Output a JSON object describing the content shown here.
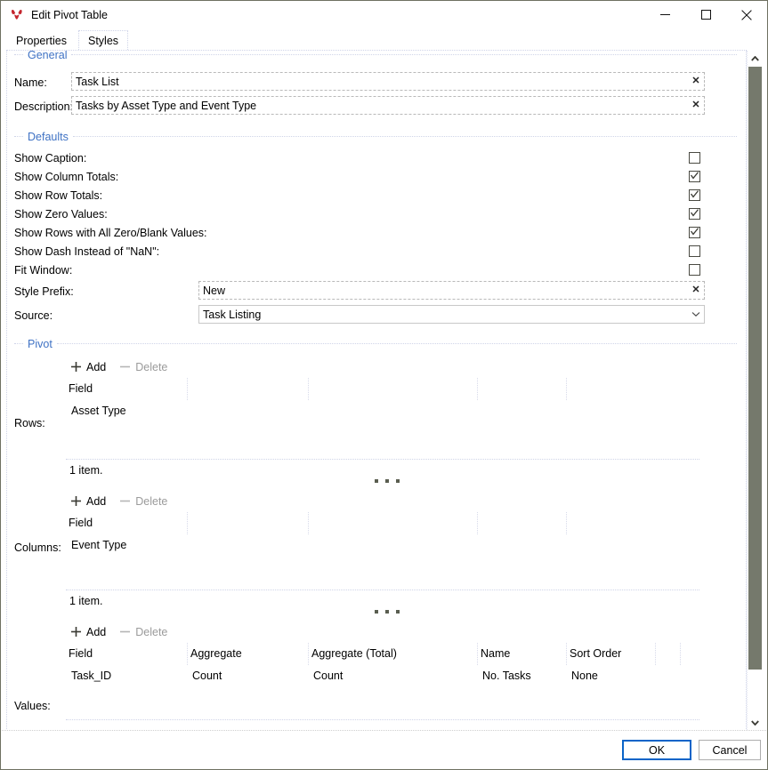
{
  "window": {
    "title": "Edit Pivot Table",
    "icon": "pivot-table-icon",
    "controls": {
      "minimize": "minimize-icon",
      "maximize": "maximize-icon",
      "close": "close-icon"
    }
  },
  "tabs": [
    {
      "label": "Properties",
      "selected": true
    },
    {
      "label": "Styles",
      "selected": false
    }
  ],
  "groups": {
    "general": "General",
    "defaults": "Defaults",
    "pivot": "Pivot"
  },
  "general": {
    "name_label": "Name:",
    "name_value": "Task List",
    "description_label": "Description:",
    "description_value": "Tasks by Asset Type and Event Type",
    "clear_icon": "clear-icon"
  },
  "defaults": {
    "checkboxes": [
      {
        "label": "Show Caption:",
        "checked": false
      },
      {
        "label": "Show Column Totals:",
        "checked": true
      },
      {
        "label": "Show Row Totals:",
        "checked": true
      },
      {
        "label": "Show Zero Values:",
        "checked": true
      },
      {
        "label": "Show Rows with All Zero/Blank Values:",
        "checked": true
      },
      {
        "label": "Show Dash Instead of \"NaN\":",
        "checked": false
      },
      {
        "label": "Fit Window:",
        "checked": false
      }
    ],
    "style_prefix_label": "Style Prefix:",
    "style_prefix_value": "New",
    "source_label": "Source:",
    "source_value": "Task Listing",
    "dropdown_icon": "chevron-down-icon"
  },
  "toolbar": {
    "add_label": "Add",
    "delete_label": "Delete",
    "add_icon": "plus-icon",
    "delete_icon": "minus-icon"
  },
  "pivot": {
    "rows": {
      "label": "Rows:",
      "columns": [
        "Field"
      ],
      "rows": [
        [
          "Asset Type"
        ]
      ],
      "item_count": "1 item."
    },
    "columns": {
      "label": "Columns:",
      "columns": [
        "Field"
      ],
      "rows": [
        [
          "Event Type"
        ]
      ],
      "item_count": "1 item."
    },
    "values": {
      "label": "Values:",
      "columns": [
        "Field",
        "Aggregate",
        "Aggregate (Total)",
        "Name",
        "Sort Order"
      ],
      "rows": [
        [
          "Task_ID",
          "Count",
          "Count",
          "No. Tasks",
          "None"
        ]
      ]
    }
  },
  "footer": {
    "ok_label": "OK",
    "cancel_label": "Cancel"
  },
  "scrollbar": {
    "up_icon": "chevron-up-icon",
    "down_icon": "chevron-down-icon"
  }
}
